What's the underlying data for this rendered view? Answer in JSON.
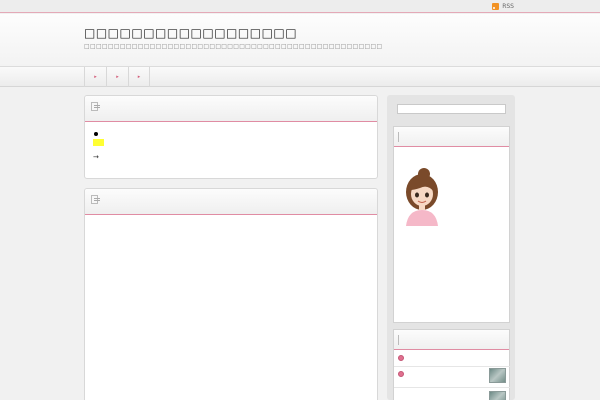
{
  "topbar": {
    "rss_label": "RSS"
  },
  "header": {
    "site_title": "□□□□□□□□□□□□□□□□□□",
    "site_description": "□□□□□□□□□□□□□□□□□□□□□□□□□□□□□□□□□□□□□□□□□□□□□□□□□□"
  },
  "nav": {
    "items": [
      "▸",
      "▸",
      "▸"
    ]
  },
  "main": {
    "panels": [
      {
        "title": "",
        "arrow": "→"
      },
      {
        "title": ""
      }
    ]
  },
  "sidebar": {
    "search": {
      "placeholder": ""
    },
    "profile": {
      "title": ""
    },
    "recent": {
      "title": "",
      "items": [
        "",
        "",
        ""
      ]
    }
  },
  "colors": {
    "accent": "#e08ca3",
    "rss": "#f29325",
    "highlight": "#ffff33"
  },
  "icons": [
    "rss-icon",
    "document-icon",
    "bullet-icon",
    "avatar"
  ]
}
